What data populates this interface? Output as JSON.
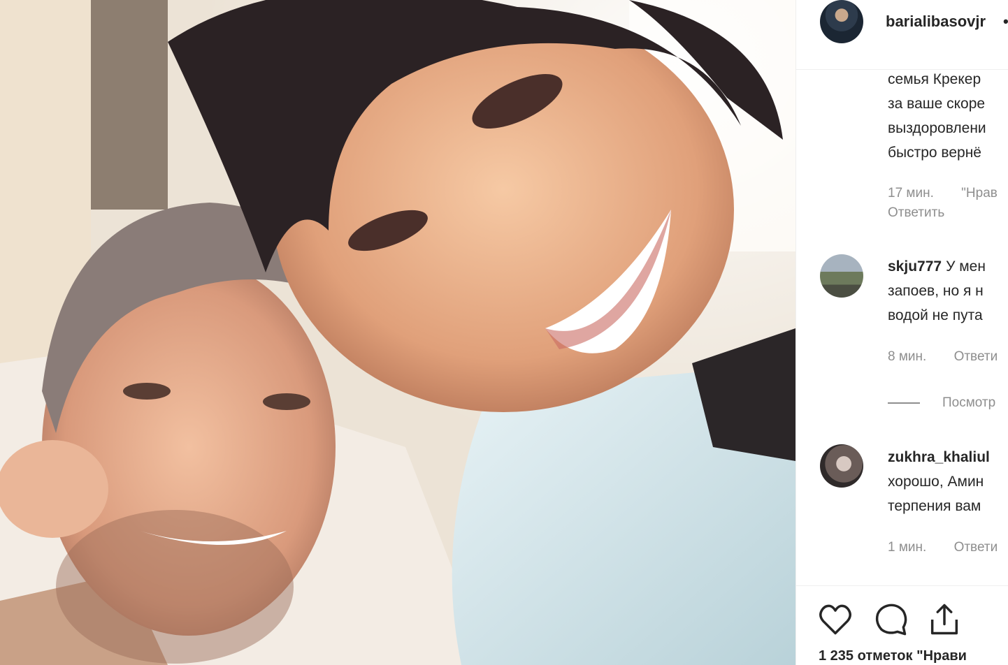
{
  "post": {
    "username": "barialibasovjr",
    "header_separator": "•"
  },
  "comments": [
    {
      "user": "",
      "lines": [
        "семья Крекер",
        "за ваше скоре",
        "выздоровлени",
        "быстро вернё"
      ],
      "time": "17 мин.",
      "likes": "\"Нрав",
      "reply": "Ответить"
    },
    {
      "user": "skju777",
      "lines": [
        "У мен",
        "запоев, но я н",
        "водой не пута"
      ],
      "time": "8 мин.",
      "reply": "Ответи"
    },
    {
      "user": "zukhra_khaliul",
      "lines": [
        "",
        "хорошо, Амин",
        "терпения вам"
      ],
      "time": "1 мин.",
      "reply": "Ответи"
    }
  ],
  "view_replies": "Посмотр",
  "likes_count": "1 235 отметок \"Нрави",
  "icons": {
    "like": "heart-icon",
    "comment": "comment-bubble-icon",
    "share": "share-icon"
  },
  "colors": {
    "text": "#262626",
    "secondary": "#8e8e8e",
    "border": "#efefef"
  }
}
